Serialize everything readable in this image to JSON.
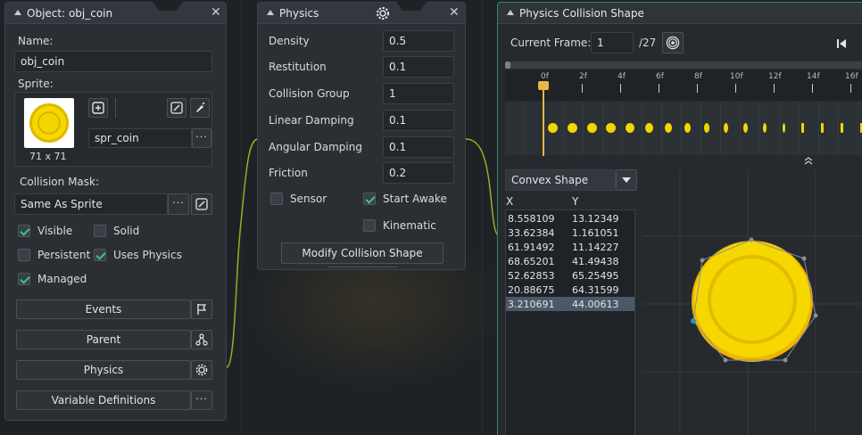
{
  "object_panel": {
    "title": "Object: obj_coin",
    "name_label": "Name:",
    "name_value": "obj_coin",
    "sprite_label": "Sprite:",
    "sprite_name": "spr_coin",
    "sprite_size": "71 x 71",
    "mask_label": "Collision Mask:",
    "mask_value": "Same As Sprite",
    "checkboxes": [
      {
        "label": "Visible",
        "checked": true
      },
      {
        "label": "Solid",
        "checked": false
      },
      {
        "label": "Persistent",
        "checked": false
      },
      {
        "label": "Uses Physics",
        "checked": true
      },
      {
        "label": "Managed",
        "checked": true
      }
    ],
    "buttons": [
      "Events",
      "Parent",
      "Physics",
      "Variable Definitions"
    ]
  },
  "physics_panel": {
    "title": "Physics",
    "rows": [
      {
        "label": "Density",
        "value": "0.5"
      },
      {
        "label": "Restitution",
        "value": "0.1"
      },
      {
        "label": "Collision Group",
        "value": "1"
      },
      {
        "label": "Linear Damping",
        "value": "0.1"
      },
      {
        "label": "Angular Damping",
        "value": "0.1"
      },
      {
        "label": "Friction",
        "value": "0.2"
      }
    ],
    "sensor_label": "Sensor",
    "sensor_checked": false,
    "start_awake_label": "Start Awake",
    "start_awake_checked": true,
    "kinematic_label": "Kinematic",
    "kinematic_checked": false,
    "modify_button": "Modify Collision Shape"
  },
  "shape_panel": {
    "title": "Physics Collision Shape",
    "current_frame_label": "Current Frame:",
    "current_frame_value": "1",
    "frame_total": "/27",
    "timeline_labels": [
      "0f",
      "2f",
      "4f",
      "6f",
      "8f",
      "10f",
      "12f",
      "14f",
      "16f"
    ],
    "shape_type": "Convex Shape",
    "col_x": "X",
    "col_y": "Y",
    "points": [
      {
        "x": "8.558109",
        "y": "13.12349"
      },
      {
        "x": "33.62384",
        "y": "1.161051"
      },
      {
        "x": "61.91492",
        "y": "11.14227"
      },
      {
        "x": "68.65201",
        "y": "41.49438"
      },
      {
        "x": "52.62853",
        "y": "65.25495"
      },
      {
        "x": "20.88675",
        "y": "64.31599"
      },
      {
        "x": "3.210691",
        "y": "44.00613"
      }
    ],
    "selected_point": 6
  },
  "colors": {
    "accent_green": "#3fc28a",
    "coin_yellow": "#f2d600",
    "wire_green": "#8fb31c",
    "selection": "#4a5868"
  }
}
